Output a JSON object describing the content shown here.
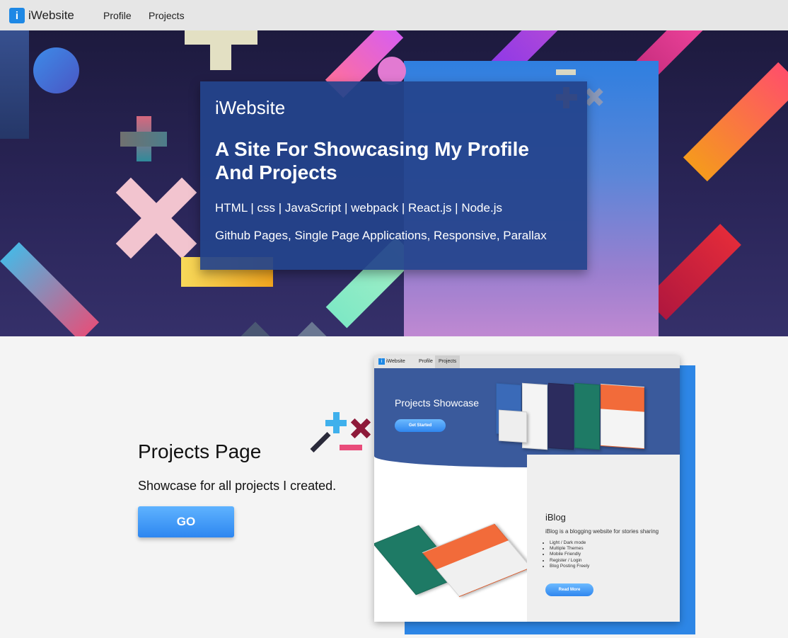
{
  "nav": {
    "logo_letter": "i",
    "brand": "iWebsite",
    "links": [
      "Profile",
      "Projects"
    ]
  },
  "hero": {
    "brand": "iWebsite",
    "title": "A Site For Showcasing My Profile And Projects",
    "tech": "HTML | css | JavaScript | webpack | React.js | Node.js",
    "extra": "Github Pages, Single Page Applications, Responsive, Parallax"
  },
  "projects": {
    "title": "Projects Page",
    "description": "Showcase for all projects I created.",
    "button": "GO"
  },
  "preview": {
    "logo_letter": "i",
    "brand": "iWebsite",
    "links": [
      "Profile",
      "Projects"
    ],
    "hero_title": "Projects Showcase",
    "hero_button": "Get Started",
    "blog_title": "iBlog",
    "blog_desc": "iBlog is a blogging website for stories sharing",
    "blog_features": [
      "Light / Dark mode",
      "Multiple Themes",
      "Mobile Friendly",
      "Register / Login",
      "Blog Posting Freely"
    ],
    "blog_button": "Read More"
  },
  "colors": {
    "nav_bg": "#e6e6e6",
    "hero_bg": "#2a2558",
    "card_bg": "#24448c",
    "accent": "#2d86f0"
  }
}
